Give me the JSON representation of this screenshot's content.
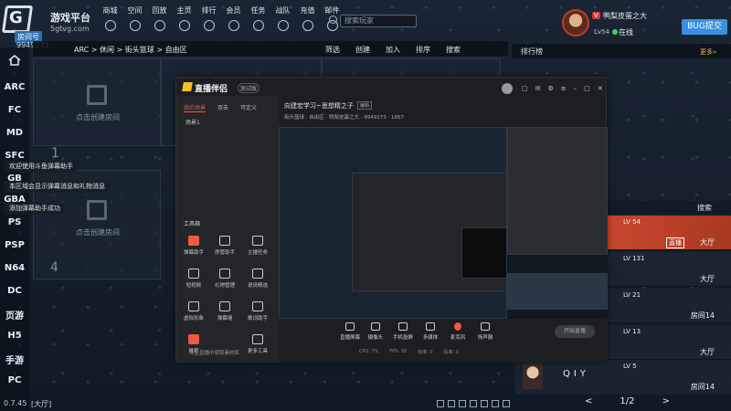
{
  "topbar": {
    "platform_title": "游戏平台",
    "url": "5gtvg.com",
    "badge": "房间号",
    "user_id": "9949273",
    "nav": [
      "商城",
      "空间",
      "回放",
      "主页",
      "排行",
      "会员",
      "任务",
      "战队",
      "充值",
      "邮件"
    ],
    "search_placeholder": "搜索玩家",
    "vip": "V",
    "username": "鸭梨皮蛋之大",
    "level": "Lv54",
    "status": "在线",
    "bug_button": "BUG提交"
  },
  "sidebar": {
    "items": [
      "ARC",
      "FC",
      "MD",
      "SFC",
      "GB",
      "GBA",
      "PS",
      "PSP",
      "N64",
      "DC",
      "页游",
      "H5",
      "手游",
      "PC"
    ],
    "version": "0.7.45"
  },
  "crumbbar": {
    "breadcrumb": "ARC > 休闲 > 街头篮球 > 自由区",
    "actions": [
      "筛选",
      "创建",
      "加入",
      "排序",
      "搜索"
    ]
  },
  "rooms": {
    "create_label": "点击创建房间",
    "numbers": [
      "1",
      "4"
    ]
  },
  "system_messages": [
    "欢迎使用斗鱼弹幕助手",
    "本区域会显示弹幕消息和礼物消息",
    "添加弹幕助手成功"
  ],
  "lobby_footer": "[大厅]",
  "right_panel": {
    "title": "排行榜",
    "more": "更多»",
    "search": "搜索",
    "rows": [
      {
        "level": "LV 54",
        "tag": "直播",
        "status": "大厅"
      },
      {
        "level": "LV 131",
        "tag": "",
        "status": "大厅"
      },
      {
        "level": "LV 21",
        "tag": "",
        "status": "房间14"
      },
      {
        "level": "LV 13",
        "tag": "",
        "status": "大厅"
      }
    ],
    "player": {
      "name": "QIY",
      "level": "LV 5",
      "status": "房间14"
    },
    "pager": {
      "prev": "<",
      "page": "1/2",
      "next": ">"
    }
  },
  "stream_app": {
    "title": "直播伴侣",
    "version": "测试版",
    "tabs": [
      "我的场景",
      "双击",
      "可定义"
    ],
    "scene": "场景1",
    "toolbox_title": "工具箱",
    "tools": [
      "弹幕助手",
      "房管助手",
      "主播任务",
      "短视频",
      "礼物管理",
      "说说精选",
      "虚拟形象",
      "弹幕墙",
      "歌词助手",
      "推荐",
      "更多工具"
    ],
    "header_text": "向建宏学习~思想精之子",
    "header_tag": "编辑",
    "sub_text": "街头篮球 · 自由区 · 鸭梨皮蛋之大 · 9949273 · 1857",
    "bottom_note": "斗鱼直播中获取素材库",
    "bar": [
      "直播屏幕",
      "摄像头",
      "手机投屏",
      "多媒体",
      "麦克风",
      "扬声器"
    ],
    "start": "开始直播",
    "stats": [
      "CPU: 7%",
      "FPS: 30",
      "帧率: 0",
      "码率: 0"
    ]
  }
}
